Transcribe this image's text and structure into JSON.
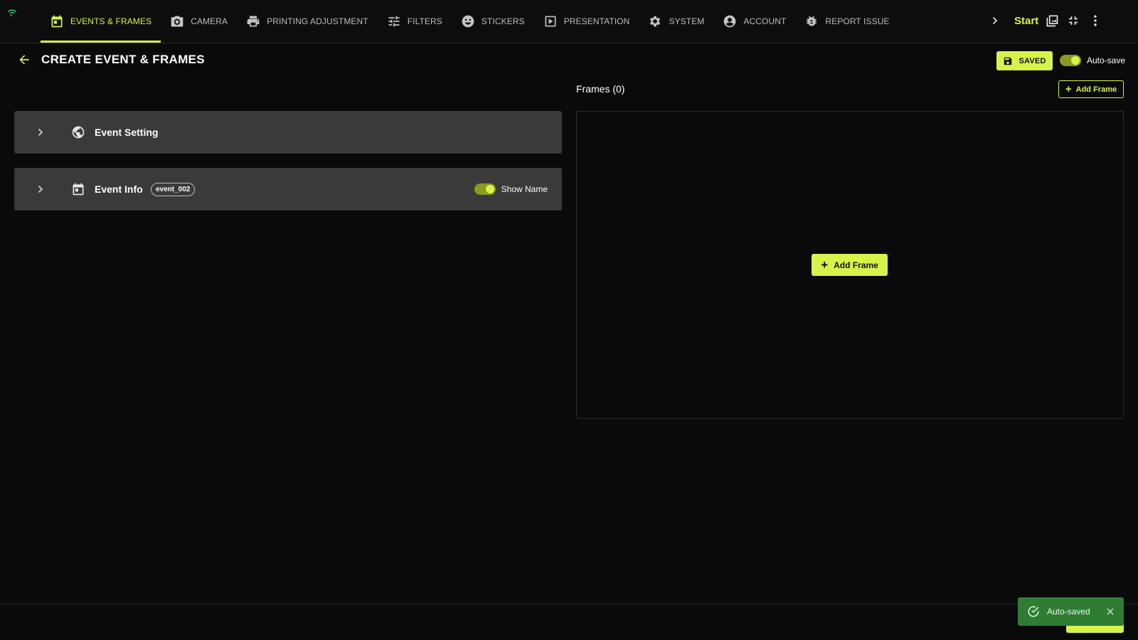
{
  "nav": {
    "items": [
      {
        "label": "EVENTS & FRAMES",
        "icon": "calendar-icon",
        "active": true
      },
      {
        "label": "CAMERA",
        "icon": "camera-icon"
      },
      {
        "label": "PRINTING ADJUSTMENT",
        "icon": "printer-icon"
      },
      {
        "label": "FILTERS",
        "icon": "sliders-icon"
      },
      {
        "label": "STICKERS",
        "icon": "smiley-icon"
      },
      {
        "label": "PRESENTATION",
        "icon": "play-icon"
      },
      {
        "label": "SYSTEM",
        "icon": "gear-icon"
      },
      {
        "label": "ACCOUNT",
        "icon": "account-icon"
      },
      {
        "label": "REPORT ISSUE",
        "icon": "bug-icon"
      }
    ],
    "start_label": "Start"
  },
  "header": {
    "title": "CREATE EVENT & FRAMES",
    "saved_label": "SAVED",
    "autosave_label": "Auto-save",
    "autosave_on": true
  },
  "panels": {
    "event_setting": {
      "title": "Event Setting"
    },
    "event_info": {
      "title": "Event Info",
      "badge": "event_002",
      "show_name_label": "Show Name",
      "show_name_on": true
    }
  },
  "frames": {
    "title": "Frames (0)",
    "add_top_label": "Add Frame",
    "add_center_label": "Add Frame"
  },
  "toast": {
    "message": "Auto-saved"
  },
  "colors": {
    "accent": "#d7f24b",
    "toast": "#2e7d32",
    "panel": "#3a3a3a",
    "background": "#0a0a0a"
  }
}
